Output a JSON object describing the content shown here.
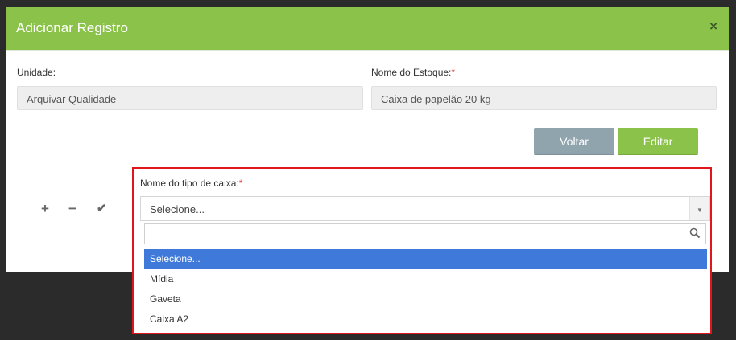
{
  "modal": {
    "title": "Adicionar Registro",
    "close_icon": "×"
  },
  "form": {
    "unidade_label": "Unidade:",
    "unidade_value": "Arquivar Qualidade",
    "estoque_label": "Nome do Estoque:",
    "estoque_value": "Caixa de papelão 20 kg",
    "required_mark": "*"
  },
  "buttons": {
    "voltar": "Voltar",
    "editar": "Editar"
  },
  "row_actions": {
    "add": "+",
    "remove": "−",
    "confirm": "✔"
  },
  "tipo_caixa": {
    "label": "Nome do tipo de caixa:",
    "selected": "Selecione...",
    "search_value": "",
    "options": [
      "Selecione...",
      "Mídia",
      "Gaveta",
      "Caixa A2"
    ]
  },
  "colors": {
    "header": "#8bc34a",
    "highlight_border": "#e0161b",
    "selected_option": "#3f79d9"
  }
}
